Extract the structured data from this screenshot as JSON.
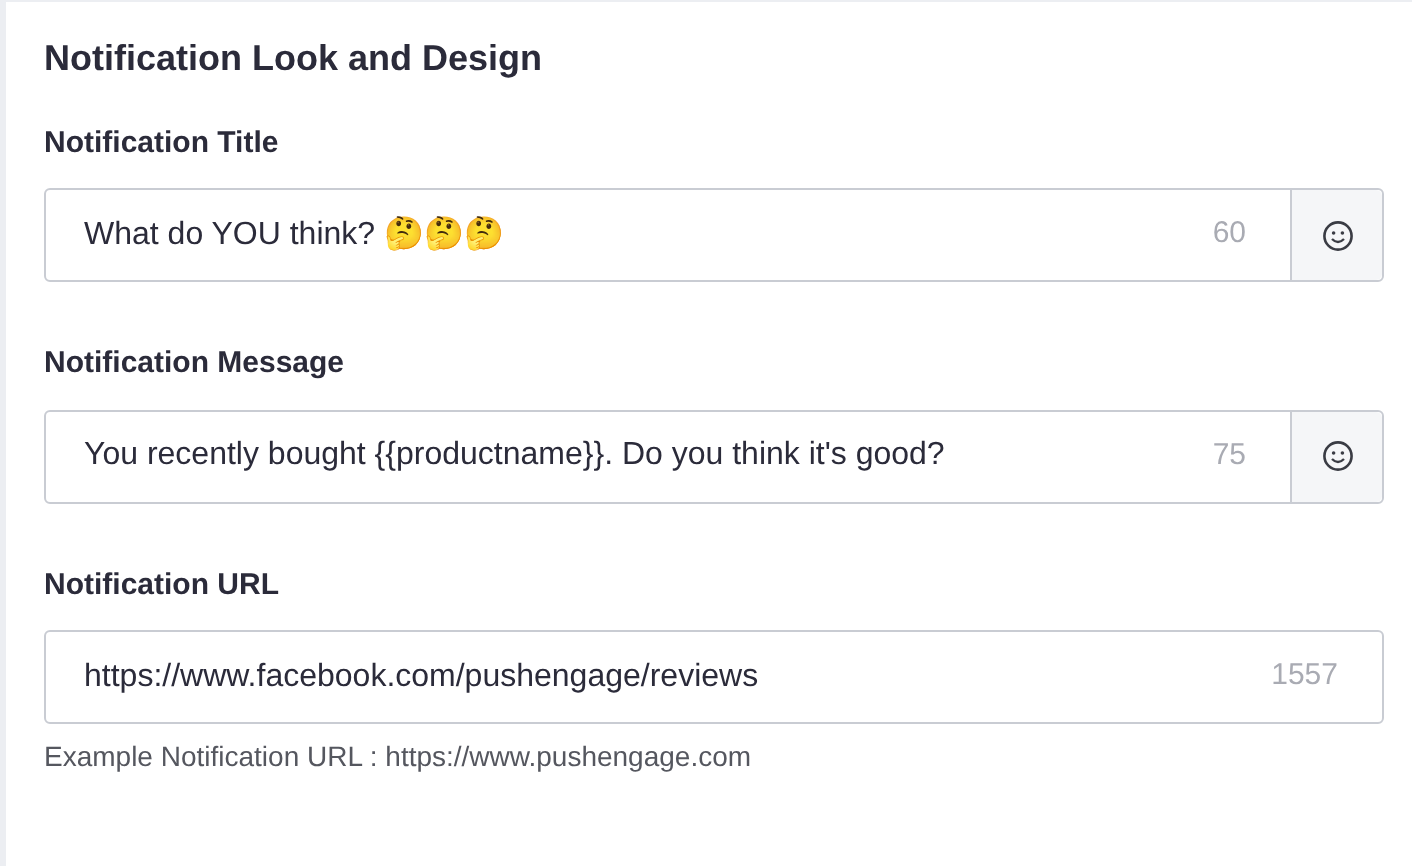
{
  "section_title": "Notification Look and Design",
  "fields": [
    {
      "label": "Notification Title",
      "value": "What do YOU think? 🤔🤔🤔",
      "count": "60",
      "emoji_button": true
    },
    {
      "label": "Notification Message",
      "value": "You recently bought {{productname}}. Do you think it's good?",
      "count": "75",
      "emoji_button": true
    },
    {
      "label": "Notification URL",
      "value": "https://www.facebook.com/pushengage/reviews",
      "count": "1557",
      "emoji_button": false,
      "help": "Example Notification URL : https://www.pushengage.com"
    }
  ]
}
